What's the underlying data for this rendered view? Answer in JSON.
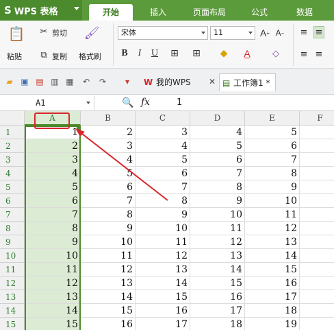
{
  "app": {
    "title": "WPS 表格"
  },
  "ribbon_tabs": [
    "开始",
    "插入",
    "页面布局",
    "公式",
    "数据"
  ],
  "ribbon": {
    "cut": "剪切",
    "paste": "粘贴",
    "copy": "复制",
    "format_painter": "格式刷",
    "font_name": "宋体",
    "font_size": "11"
  },
  "doc_tabs": {
    "home": "我的WPS",
    "workbook": "工作簿1 *"
  },
  "formula_bar": {
    "cell_ref": "A1",
    "fx_label": "fx",
    "value": "1"
  },
  "grid": {
    "columns": [
      "A",
      "B",
      "C",
      "D",
      "E",
      "F"
    ],
    "rows": [
      [
        "1",
        "1",
        "2",
        "3",
        "4",
        "5"
      ],
      [
        "2",
        "2",
        "3",
        "4",
        "5",
        "6"
      ],
      [
        "3",
        "3",
        "4",
        "5",
        "6",
        "7"
      ],
      [
        "4",
        "4",
        "5",
        "6",
        "7",
        "8"
      ],
      [
        "5",
        "5",
        "6",
        "7",
        "8",
        "9"
      ],
      [
        "6",
        "6",
        "7",
        "8",
        "9",
        "10"
      ],
      [
        "7",
        "7",
        "8",
        "9",
        "10",
        "11"
      ],
      [
        "8",
        "8",
        "9",
        "10",
        "11",
        "12"
      ],
      [
        "9",
        "9",
        "10",
        "11",
        "12",
        "13"
      ],
      [
        "10",
        "10",
        "11",
        "12",
        "13",
        "14"
      ],
      [
        "11",
        "11",
        "12",
        "13",
        "14",
        "15"
      ],
      [
        "12",
        "12",
        "13",
        "14",
        "15",
        "16"
      ],
      [
        "13",
        "13",
        "14",
        "15",
        "16",
        "17"
      ],
      [
        "14",
        "14",
        "15",
        "16",
        "17",
        "18"
      ],
      [
        "15",
        "15",
        "16",
        "17",
        "18",
        "19"
      ]
    ]
  },
  "colors": {
    "brand_green": "#5c9b3c",
    "selection_green": "#4a8a2a",
    "selection_fill": "#dcebd3",
    "annotation_red": "#d8262c"
  }
}
